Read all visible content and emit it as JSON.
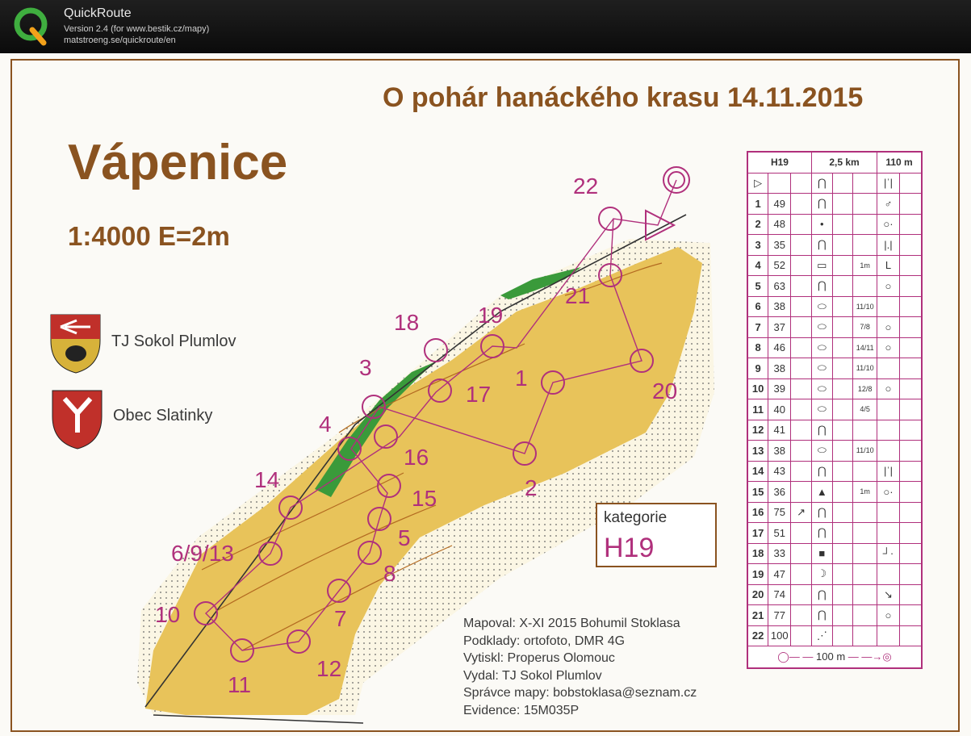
{
  "app": {
    "title": "QuickRoute",
    "version": "Version 2.4  (for www.bestik.cz/mapy)",
    "url": "matstroeng.se/quickroute/en"
  },
  "map": {
    "event_title": "O pohár hanáckého krasu 14.11.2015",
    "area_name": "Vápenice",
    "scale": "1:4000 E=2m",
    "clubs": [
      "TJ Sokol Plumlov",
      "Obec Slatinky"
    ],
    "control_labels": [
      "22",
      "21",
      "18",
      "19",
      "3",
      "1",
      "17",
      "20",
      "4",
      "16",
      "2",
      "14",
      "15",
      "5",
      "6/9/13",
      "8",
      "10",
      "7",
      "12",
      "11"
    ],
    "category": {
      "label": "kategorie",
      "value": "H19"
    },
    "imprint": [
      "Mapoval: X-XI 2015 Bohumil Stoklasa",
      "Podklady: ortofoto, DMR 4G",
      "Vytiskl: Properus Olomouc",
      "Vydal: TJ Sokol Plumlov",
      "Správce mapy: bobstoklasa@seznam.cz",
      "Evidence: 15M035P"
    ],
    "colors": {
      "brown": "#8a5320",
      "magenta": "#b0307c",
      "yellow": "#e8c35a",
      "green": "#3a9a3a",
      "paper": "#fbfaf6"
    }
  },
  "control_table": {
    "header": [
      "H19",
      "2,5 km",
      "110 m"
    ],
    "rows": [
      {
        "n": "1",
        "code": "49"
      },
      {
        "n": "2",
        "code": "48"
      },
      {
        "n": "3",
        "code": "35"
      },
      {
        "n": "4",
        "code": "52",
        "extra": "1m"
      },
      {
        "n": "5",
        "code": "63"
      },
      {
        "n": "6",
        "code": "38",
        "frac": "11/10"
      },
      {
        "n": "7",
        "code": "37",
        "frac": "7/8"
      },
      {
        "n": "8",
        "code": "46",
        "frac": "14/11"
      },
      {
        "n": "9",
        "code": "38",
        "frac": "11/10"
      },
      {
        "n": "10",
        "code": "39",
        "frac": "12/8"
      },
      {
        "n": "11",
        "code": "40",
        "frac": "4/5"
      },
      {
        "n": "12",
        "code": "41"
      },
      {
        "n": "13",
        "code": "38",
        "frac": "11/10"
      },
      {
        "n": "14",
        "code": "43"
      },
      {
        "n": "15",
        "code": "36",
        "extra": "1m"
      },
      {
        "n": "16",
        "code": "75"
      },
      {
        "n": "17",
        "code": "51"
      },
      {
        "n": "18",
        "code": "33"
      },
      {
        "n": "19",
        "code": "47"
      },
      {
        "n": "20",
        "code": "74"
      },
      {
        "n": "21",
        "code": "77"
      },
      {
        "n": "22",
        "code": "100"
      }
    ],
    "finish_distance": "100 m"
  }
}
